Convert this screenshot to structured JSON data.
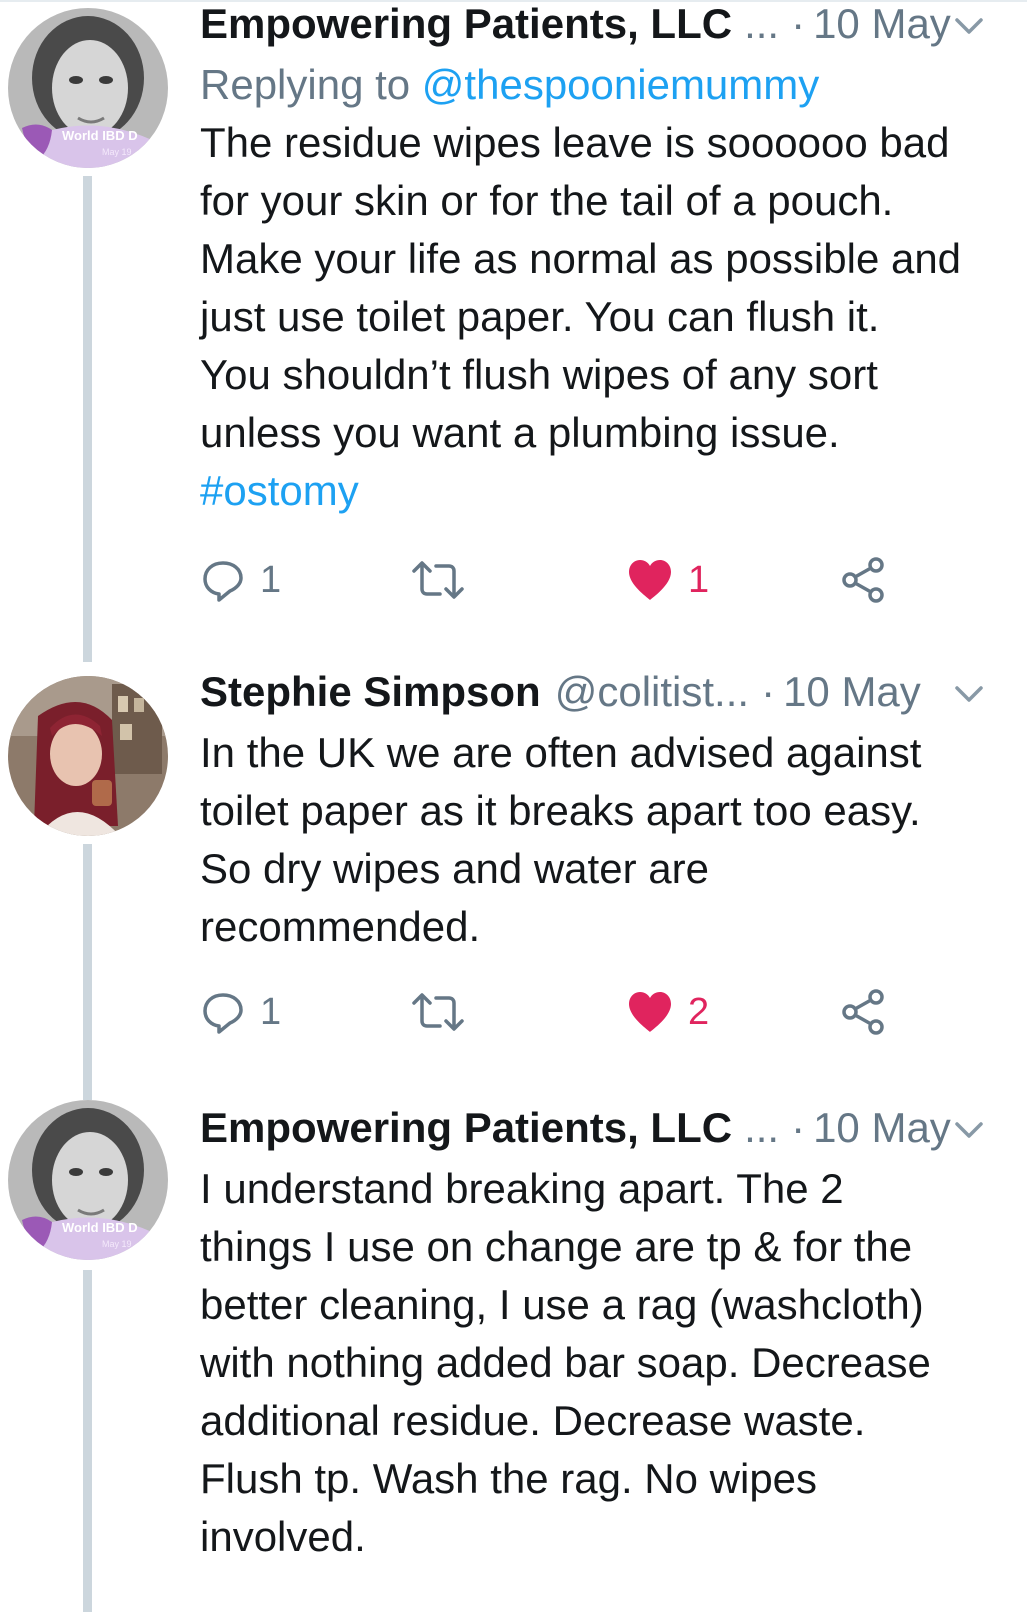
{
  "tweets": [
    {
      "author_name": "Empowering Patients, LLC",
      "author_handle": "",
      "ellipsis": "...",
      "dot": "·",
      "date": "10 May",
      "replying_prefix": "Replying to ",
      "replying_handle": "@thespooniemummy",
      "avatar_badge_text": "World IBD D",
      "avatar_badge_sub": "May 19",
      "lines": [
        "The residue wipes leave is soooooo bad",
        "for your skin or for the tail of a pouch.",
        "Make your life as normal as possible and",
        "just use toilet paper. You can flush it.",
        "You shouldn’t flush wipes of any sort",
        "unless you want a plumbing issue."
      ],
      "hashtag": "#ostomy",
      "reply_count": "1",
      "retweet_count": "",
      "like_count": "1"
    },
    {
      "author_name": "Stephie Simpson",
      "author_handle": "@colitist...",
      "dot": "·",
      "date": "10 May",
      "lines": [
        "In the UK we are often advised against",
        "toilet paper as it breaks apart too easy.",
        "So dry wipes and water are",
        "recommended."
      ],
      "reply_count": "1",
      "retweet_count": "",
      "like_count": "2"
    },
    {
      "author_name": "Empowering Patients, LLC",
      "ellipsis": "...",
      "dot": "·",
      "date": "10 May",
      "avatar_badge_text": "World IBD D",
      "avatar_badge_sub": "May 19",
      "lines": [
        "I understand breaking apart. The 2",
        "things I use on change are tp & for the",
        "better cleaning, I use a rag (washcloth)",
        "with nothing added bar soap. Decrease",
        "additional residue. Decrease waste.",
        "Flush tp. Wash the rag. No wipes",
        "involved."
      ]
    }
  ],
  "colors": {
    "link": "#1da1f2",
    "like": "#e0245e",
    "muted": "#657786",
    "thread_line": "#ccd6dd"
  },
  "icons": [
    "reply-icon",
    "retweet-icon",
    "heart-icon",
    "share-icon",
    "chevron-down-icon"
  ]
}
